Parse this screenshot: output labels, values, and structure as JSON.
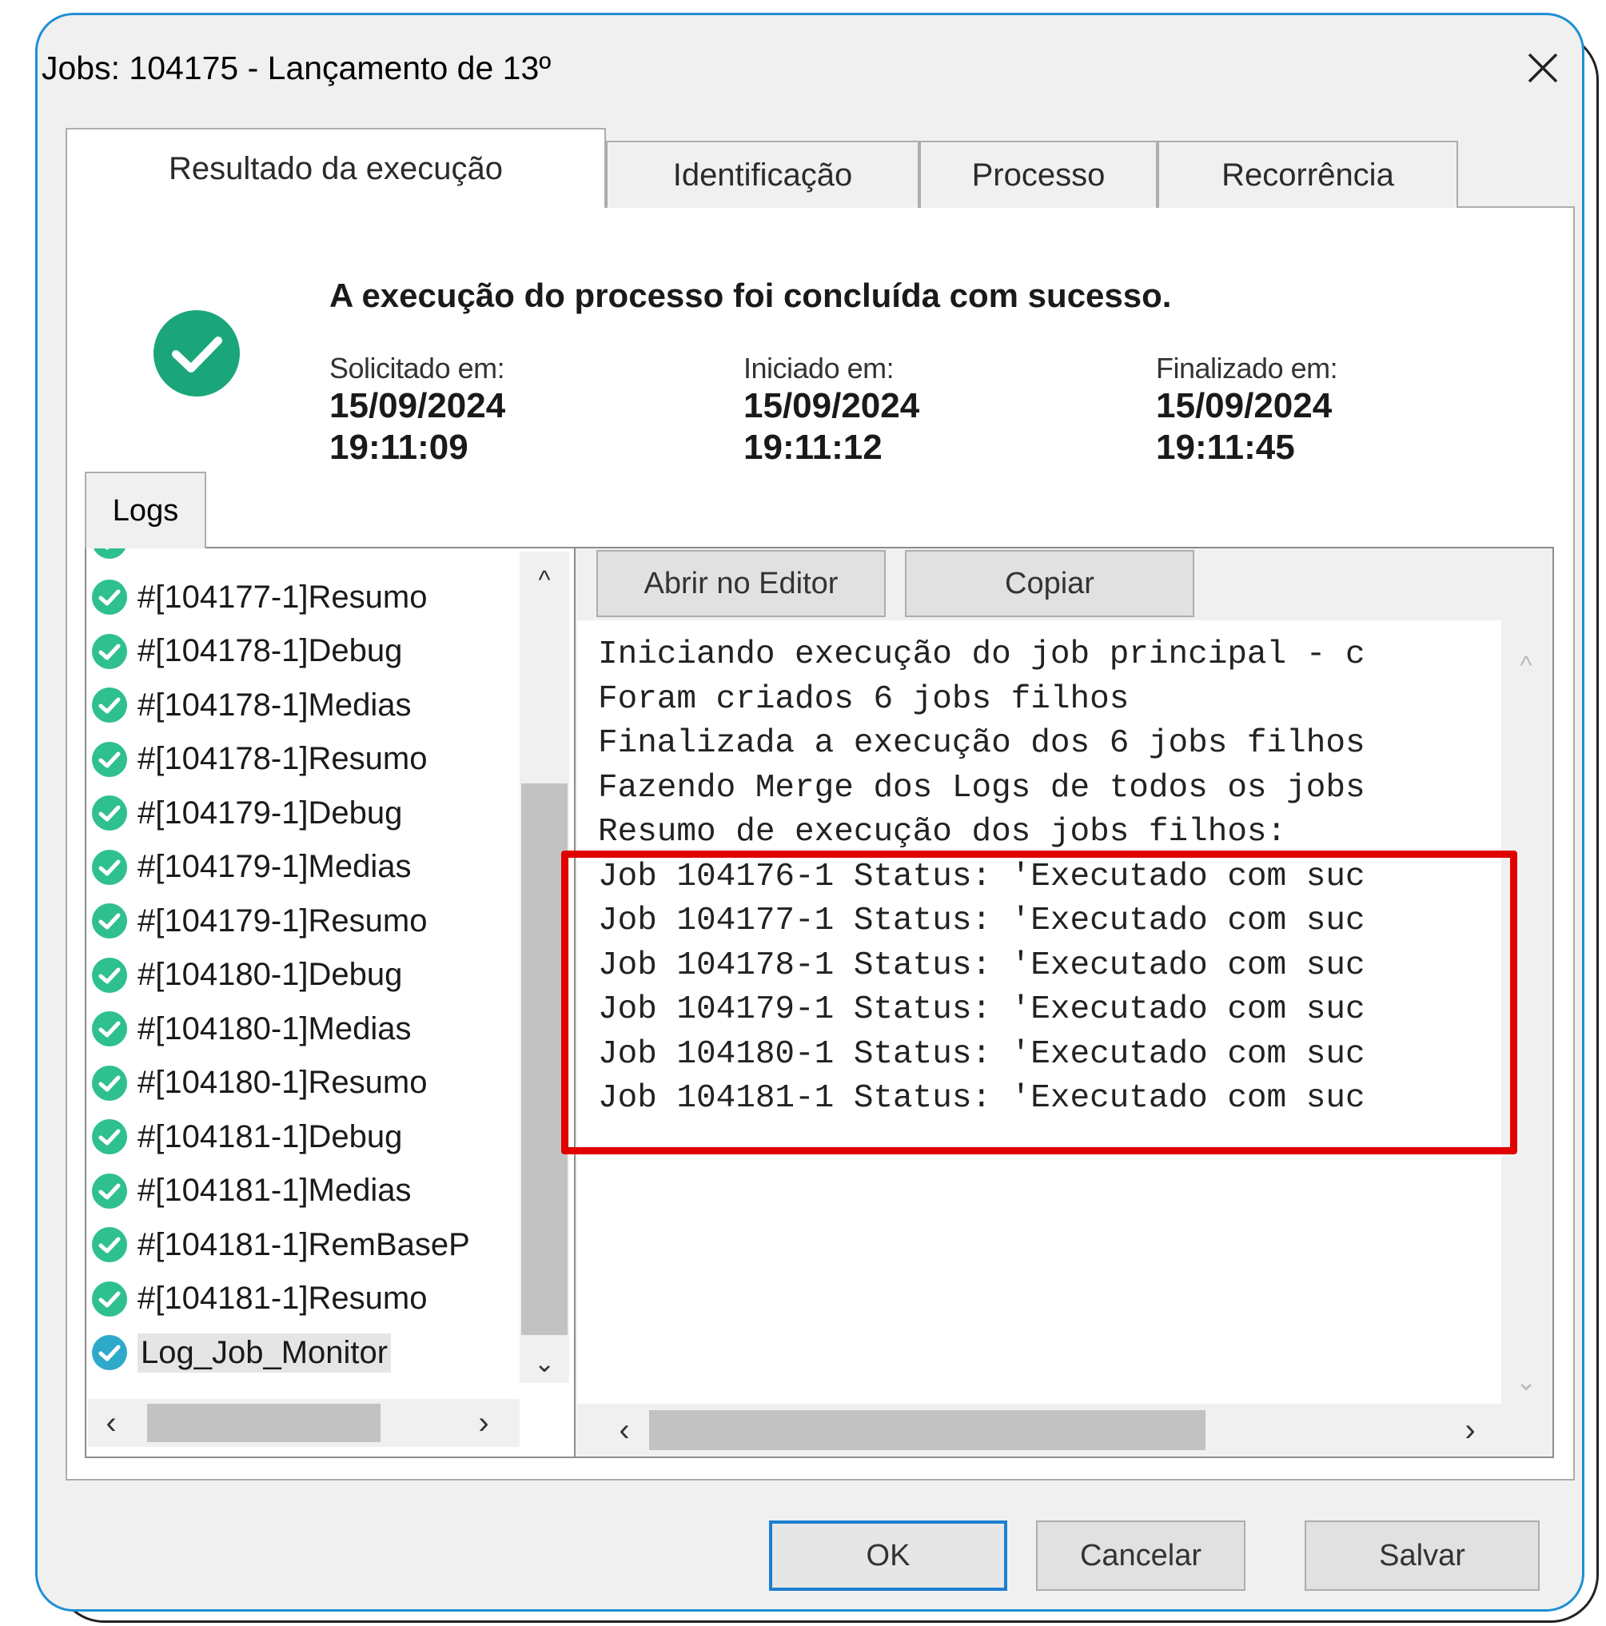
{
  "window": {
    "title": "Jobs: 104175 - Lançamento de 13º"
  },
  "tabs": [
    {
      "label": "Resultado da execução",
      "active": true
    },
    {
      "label": "Identificação",
      "active": false
    },
    {
      "label": "Processo",
      "active": false
    },
    {
      "label": "Recorrência",
      "active": false
    }
  ],
  "summary": {
    "message": "A execução do processo foi concluída com sucesso.",
    "requested": {
      "label": "Solicitado em:",
      "date": "15/09/2024",
      "time": "19:11:09"
    },
    "started": {
      "label": "Iniciado em:",
      "date": "15/09/2024",
      "time": "19:11:12"
    },
    "finished": {
      "label": "Finalizado em:",
      "date": "15/09/2024",
      "time": "19:11:45"
    }
  },
  "logs": {
    "tab_label": "Logs",
    "items": [
      "#[104177-1]Resumo",
      "#[104178-1]Debug",
      "#[104178-1]Medias",
      "#[104178-1]Resumo",
      "#[104179-1]Debug",
      "#[104179-1]Medias",
      "#[104179-1]Resumo",
      "#[104180-1]Debug",
      "#[104180-1]Medias",
      "#[104180-1]Resumo",
      "#[104181-1]Debug",
      "#[104181-1]Medias",
      "#[104181-1]RemBaseP",
      "#[104181-1]Resumo",
      "Log_Job_Monitor"
    ],
    "selected_item": "Log_Job_Monitor"
  },
  "log_toolbar": {
    "open_editor_label": "Abrir no Editor",
    "copy_label": "Copiar"
  },
  "console_lines": [
    "Iniciando execução do job principal - c",
    "Foram criados 6 jobs filhos",
    "Finalizada a execução dos 6 jobs filhos",
    "Fazendo Merge dos Logs de todos os jobs",
    "Resumo de execução dos jobs filhos:",
    "Job 104176-1 Status: 'Executado com suc",
    "Job 104177-1 Status: 'Executado com suc",
    "Job 104178-1 Status: 'Executado com suc",
    "Job 104179-1 Status: 'Executado com suc",
    "Job 104180-1 Status: 'Executado com suc",
    "Job 104181-1 Status: 'Executado com suc"
  ],
  "footer": {
    "ok_label": "OK",
    "cancel_label": "Cancelar",
    "save_label": "Salvar"
  },
  "colors": {
    "success": "#1aa67a",
    "highlight": "#e00000",
    "window_border": "#1e8fd6"
  },
  "icons": {
    "close": "close-icon",
    "success": "check-circle-icon"
  }
}
